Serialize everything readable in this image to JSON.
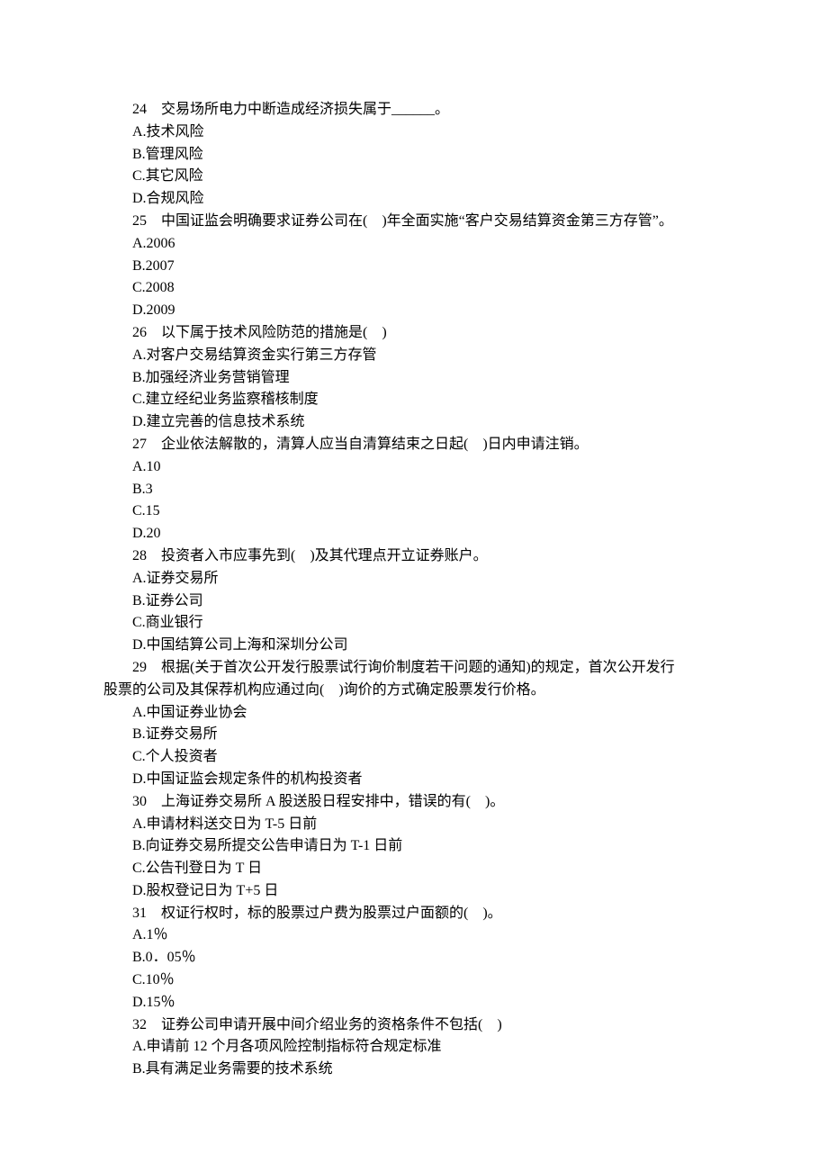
{
  "questions": [
    {
      "num": "24",
      "text": "　交易场所电力中断造成经济损失属于______。",
      "options": [
        "A.技术风险",
        "B.管理风险",
        "C.其它风险",
        "D.合规风险"
      ]
    },
    {
      "num": "25",
      "text": "　中国证监会明确要求证券公司在(　)年全面实施“客户交易结算资金第三方存管”。",
      "options": [
        "A.2006",
        "B.2007",
        "C.2008",
        "D.2009"
      ]
    },
    {
      "num": "26",
      "text": "　以下属于技术风险防范的措施是(　)",
      "options": [
        "A.对客户交易结算资金实行第三方存管",
        "B.加强经济业务营销管理",
        "C.建立经纪业务监察稽核制度",
        "D.建立完善的信息技术系统"
      ]
    },
    {
      "num": "27",
      "text": "　企业依法解散的，清算人应当自清算结束之日起(　)日内申请注销。",
      "options": [
        "A.10",
        "B.3",
        "C.15",
        "D.20"
      ]
    },
    {
      "num": "28",
      "text": "　投资者入市应事先到(　)及其代理点开立证券账户。",
      "options": [
        "A.证券交易所",
        "B.证券公司",
        "C.商业银行",
        "D.中国结算公司上海和深圳分公司"
      ]
    },
    {
      "num": "29",
      "text": "　根据(关于首次公开发行股票试行询价制度若干问题的通知)的规定，首次公开发行",
      "continuation": "股票的公司及其保荐机构应通过向(　)询价的方式确定股票发行价格。",
      "options": [
        "A.中国证券业协会",
        "B.证券交易所",
        "C.个人投资者",
        "D.中国证监会规定条件的机构投资者"
      ]
    },
    {
      "num": "30",
      "text": "　上海证券交易所 A 股送股日程安排中，错误的有(　)。",
      "options": [
        "A.申请材料送交日为 T-5 日前",
        "B.向证券交易所提交公告申请日为 T-1 日前",
        "C.公告刊登日为 T 日",
        "D.股权登记日为 T+5 日"
      ]
    },
    {
      "num": "31",
      "text": "　权证行权时，标的股票过户费为股票过户面额的(　)。",
      "options": [
        "A.1％",
        "B.0．05％",
        "C.10％",
        "D.15％"
      ]
    },
    {
      "num": "32",
      "text": "　证券公司申请开展中间介绍业务的资格条件不包括(　)",
      "options": [
        "A.申请前 12 个月各项风险控制指标符合规定标准",
        "B.具有满足业务需要的技术系统"
      ]
    }
  ]
}
